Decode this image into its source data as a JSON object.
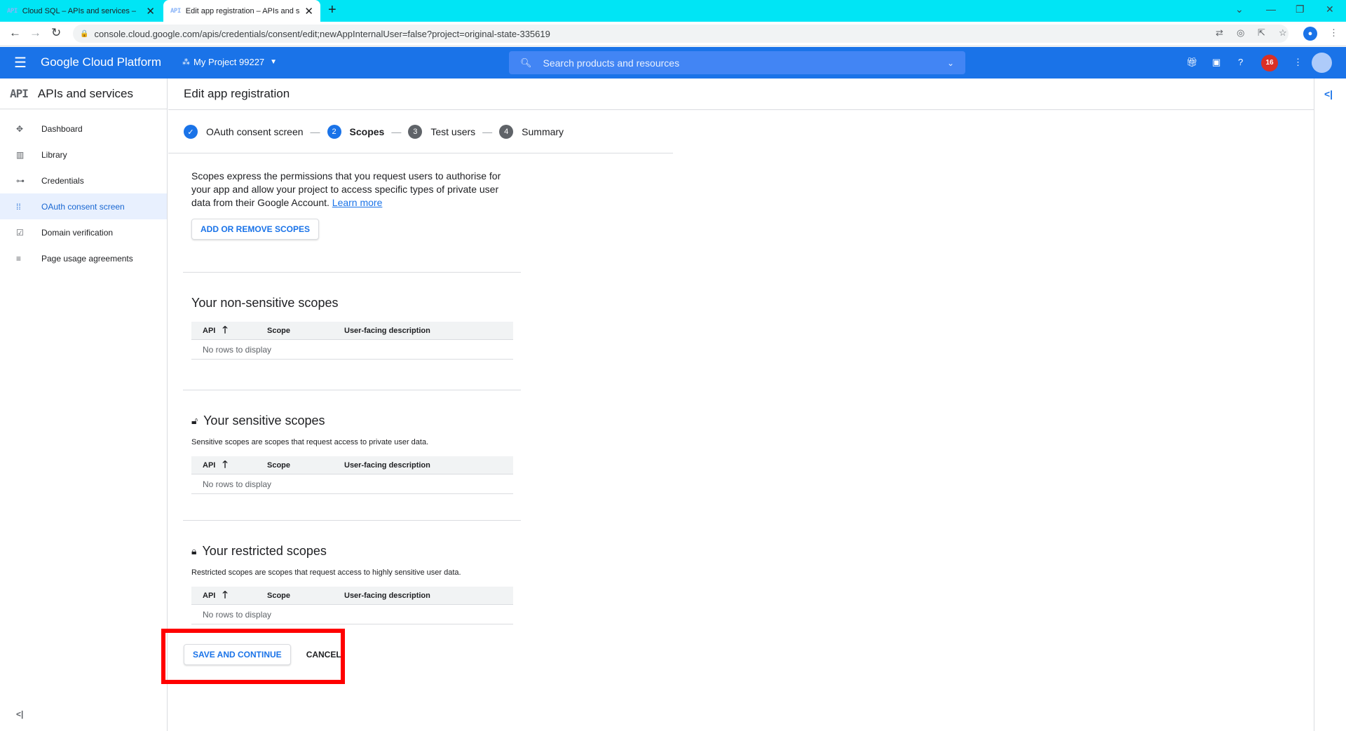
{
  "browser": {
    "tabs": [
      {
        "favicon": "API",
        "title": "Cloud SQL – APIs and services – ",
        "close": "✕"
      },
      {
        "favicon": "API",
        "title": "Edit app registration – APIs and s",
        "close": "✕"
      }
    ],
    "new_tab": "+",
    "url": "console.cloud.google.com/apis/credentials/consent/edit;newAppInternalUser=false?project=original-state-335619"
  },
  "header": {
    "brand": "Google Cloud Platform",
    "project": "My Project 99227",
    "search_placeholder": "Search products and resources",
    "notifications_count": "16"
  },
  "sidebar": {
    "badge": "API",
    "title": "APIs and services",
    "items": [
      {
        "label": "Dashboard",
        "icon": "dashboard-icon",
        "glyph": "✥"
      },
      {
        "label": "Library",
        "icon": "library-icon",
        "glyph": "▥"
      },
      {
        "label": "Credentials",
        "icon": "key-icon",
        "glyph": "⊶"
      },
      {
        "label": "OAuth consent screen",
        "icon": "consent-icon",
        "glyph": "⁞⁞"
      },
      {
        "label": "Domain verification",
        "icon": "checkbox-icon",
        "glyph": "☑"
      },
      {
        "label": "Page usage agreements",
        "icon": "settings-list-icon",
        "glyph": "≡"
      }
    ],
    "active_index": 3
  },
  "page": {
    "title": "Edit app registration",
    "steps": [
      {
        "num": "✓",
        "label": "OAuth consent screen",
        "state": "done"
      },
      {
        "num": "2",
        "label": "Scopes",
        "state": "current"
      },
      {
        "num": "3",
        "label": "Test users",
        "state": "todo"
      },
      {
        "num": "4",
        "label": "Summary",
        "state": "todo"
      }
    ],
    "step_separator": "—",
    "intro": "Scopes express the permissions that you request users to authorise for your app and allow your project to access specific types of private user data from their Google Account. ",
    "learn_more": "Learn more",
    "add_scopes_button": "ADD OR REMOVE SCOPES",
    "table_columns": {
      "api": "API",
      "scope": "Scope",
      "description": "User-facing description"
    },
    "sort_arrow": "🡑",
    "empty_row": "No rows to display",
    "sections": {
      "non_sensitive": {
        "title": "Your non-sensitive scopes"
      },
      "sensitive": {
        "title": "Your sensitive scopes",
        "desc": "Sensitive scopes are scopes that request access to private user data."
      },
      "restricted": {
        "title": "Your restricted scopes",
        "desc": "Restricted scopes are scopes that request access to highly sensitive user data."
      }
    },
    "save_button": "SAVE AND CONTINUE",
    "cancel_button": "CANCEL"
  },
  "colors": {
    "accent": "#1a73e8",
    "tabstrip": "#00e5f5",
    "highlight": "#ff0000",
    "notification": "#d93025"
  }
}
